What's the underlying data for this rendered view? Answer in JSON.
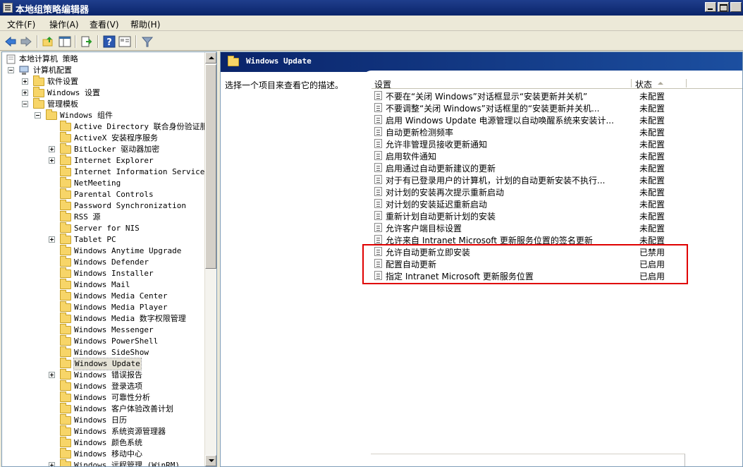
{
  "window": {
    "title": "本地组策略编辑器"
  },
  "menu": [
    {
      "label": "文件(F)"
    },
    {
      "label": "操作(A)"
    },
    {
      "label": "查看(V)"
    },
    {
      "label": "帮助(H)"
    }
  ],
  "toolbar": {
    "icons": [
      "back-arrow-icon",
      "forward-arrow-icon",
      "up-folder-icon",
      "show-hide-tree-icon",
      "export-list-icon",
      "help-icon",
      "properties-icon",
      "filter-icon"
    ]
  },
  "tree": {
    "root": "本地计算机 策略",
    "computer_config": "计算机配置",
    "software_settings": "软件设置",
    "windows_settings": "Windows 设置",
    "admin_templates": "管理模板",
    "windows_components": "Windows 组件",
    "items": [
      "Active Directory 联合身份验证服",
      "ActiveX 安装程序服务",
      "BitLocker 驱动器加密",
      "Internet Explorer",
      "Internet Information Services",
      "NetMeeting",
      "Parental Controls",
      "Password Synchronization",
      "RSS 源",
      "Server for NIS",
      "Tablet PC",
      "Windows Anytime Upgrade",
      "Windows Defender",
      "Windows Installer",
      "Windows Mail",
      "Windows Media Center",
      "Windows Media Player",
      "Windows Media 数字权限管理",
      "Windows Messenger",
      "Windows PowerShell",
      "Windows SideShow",
      "Windows Update",
      "Windows 错误报告",
      "Windows 登录选项",
      "Windows 可靠性分析",
      "Windows 客户体验改善计划",
      "Windows 日历",
      "Windows 系统资源管理器",
      "Windows 颜色系统",
      "Windows 移动中心",
      "Windows 远程管理 (WinRM)"
    ]
  },
  "right": {
    "header": "Windows Update",
    "description": "选择一个项目来查看它的描述。",
    "col_setting": "设置",
    "col_status": "状态",
    "rows": [
      {
        "name": "不要在“关闭 Windows”对话框显示“安装更新并关机”",
        "status": "未配置"
      },
      {
        "name": "不要调整“关闭 Windows”对话框里的“安装更新并关机...",
        "status": "未配置"
      },
      {
        "name": "启用 Windows Update 电源管理以自动唤醒系统来安装计...",
        "status": "未配置"
      },
      {
        "name": "自动更新检测频率",
        "status": "未配置"
      },
      {
        "name": "允许非管理员接收更新通知",
        "status": "未配置"
      },
      {
        "name": "启用软件通知",
        "status": "未配置"
      },
      {
        "name": "启用通过自动更新建议的更新",
        "status": "未配置"
      },
      {
        "name": "对于有已登录用户的计算机，计划的自动更新安装不执行...",
        "status": "未配置"
      },
      {
        "name": "对计划的安装再次提示重新启动",
        "status": "未配置"
      },
      {
        "name": "对计划的安装延迟重新启动",
        "status": "未配置"
      },
      {
        "name": "重新计划自动更新计划的安装",
        "status": "未配置"
      },
      {
        "name": "允许客户端目标设置",
        "status": "未配置"
      },
      {
        "name": "允许来自 Intranet Microsoft 更新服务位置的签名更新",
        "status": "未配置"
      },
      {
        "name": "允许自动更新立即安装",
        "status": "已禁用"
      },
      {
        "name": "配置自动更新",
        "status": "已启用"
      },
      {
        "name": "指定 Intranet Microsoft 更新服务位置",
        "status": "已启用"
      }
    ]
  },
  "colors": {
    "titlebar": "#0a246a",
    "highlight_box": "#e00000"
  }
}
